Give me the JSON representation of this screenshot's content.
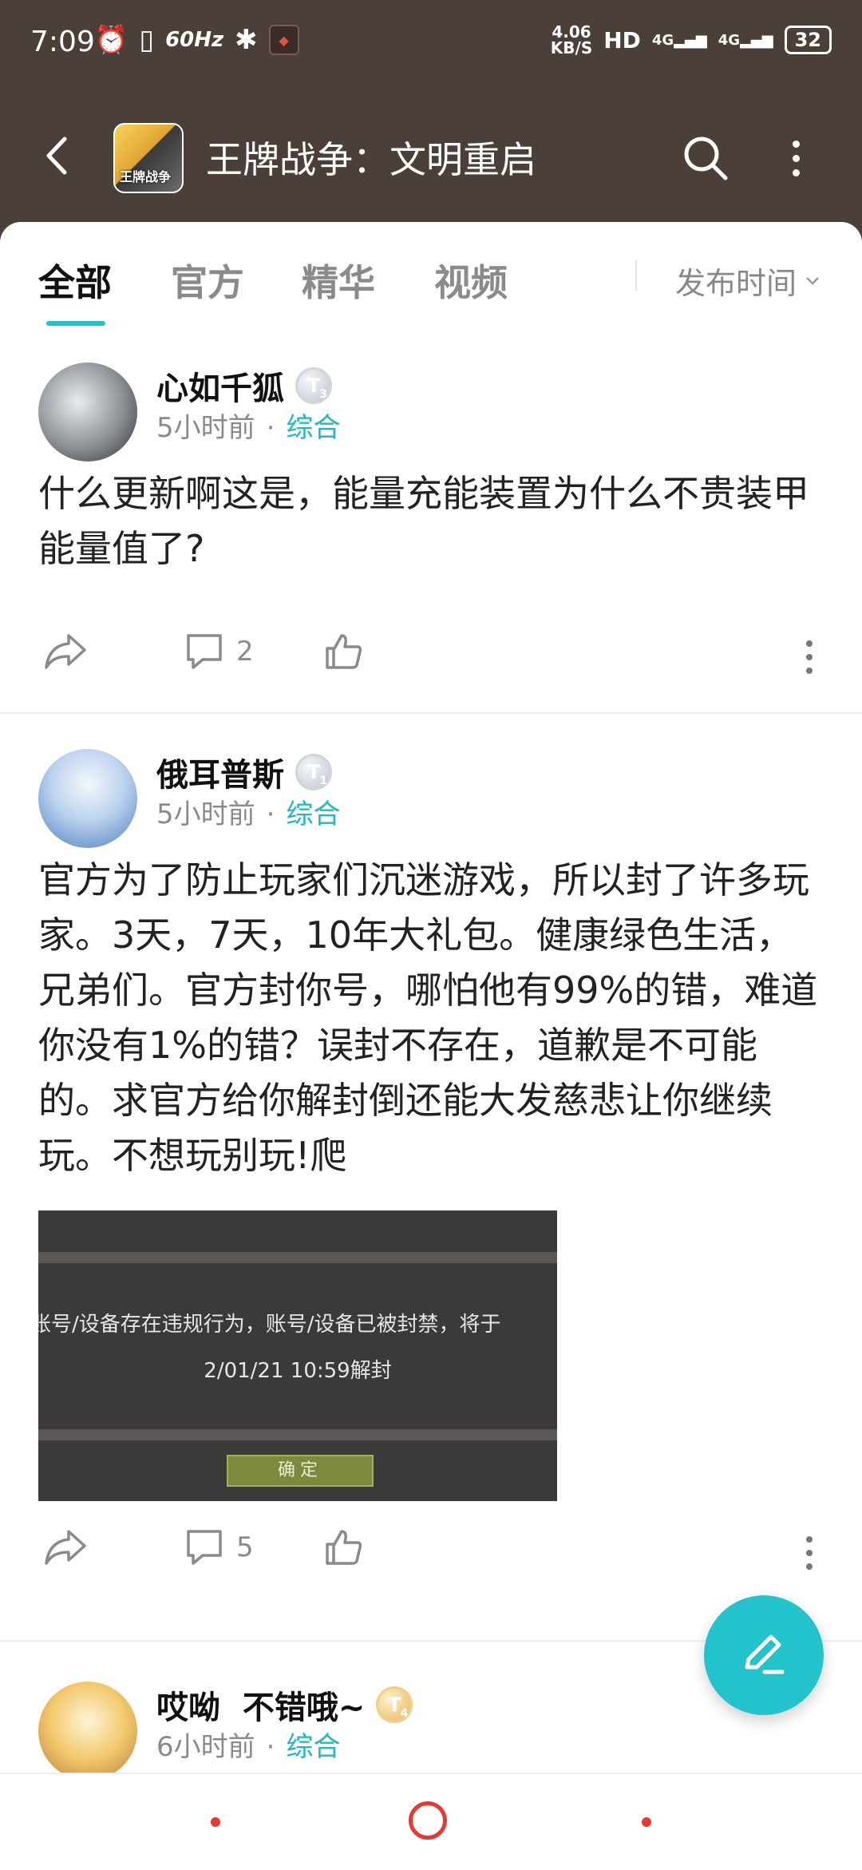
{
  "status_bar": {
    "time": "7:09",
    "refresh_rate": "60Hz",
    "net_speed_value": "4.06",
    "net_speed_unit": "KB/S",
    "hd": "HD",
    "network": "4G",
    "network2": "4G",
    "battery": "32"
  },
  "header": {
    "title": "王牌战争：文明重启",
    "game_icon_text": "王牌战争"
  },
  "tabs": [
    {
      "label": "全部",
      "active": true
    },
    {
      "label": "官方",
      "active": false
    },
    {
      "label": "精华",
      "active": false
    },
    {
      "label": "视频",
      "active": false
    }
  ],
  "sort_label": "发布时间",
  "posts": [
    {
      "username": "心如千狐",
      "level_letter": "T",
      "level_num": "3",
      "time": "5小时前",
      "category": "综合",
      "text": "什么更新啊这是，能量充能装置为什么不贵装甲能量值了?",
      "comments": "2"
    },
    {
      "username": "俄耳普斯",
      "level_letter": "T",
      "level_num": "1",
      "time": "5小时前",
      "category": "综合",
      "text": "官方为了防止玩家们沉迷游戏，所以封了许多玩家。3天，7天，10年大礼包。健康绿色生活，兄弟们。官方封你号，哪怕他有99%的错，难道你没有1%的错？误封不存在，道歉是不可能的。求官方给你解封倒还能大发慈悲让你继续玩。不想玩别玩!爬",
      "comments": "5",
      "image": {
        "message": "账号/设备存在违规行为，账号/设备已被封禁，将于",
        "unban_time": "2/01/21 10:59解封",
        "button": "确定"
      }
    },
    {
      "username": "哎呦  不错哦~",
      "level_letter": "T",
      "level_num": "4",
      "time": "6小时前",
      "category": "综合"
    }
  ],
  "colors": {
    "accent": "#22c3cc",
    "header_bg": "#4a3f39",
    "nav_red": "#e53935"
  },
  "icons": [
    "back-arrow-icon",
    "search-icon",
    "more-vertical-icon",
    "share-icon",
    "comment-icon",
    "like-icon",
    "edit-pen-icon",
    "chevron-down-icon"
  ]
}
